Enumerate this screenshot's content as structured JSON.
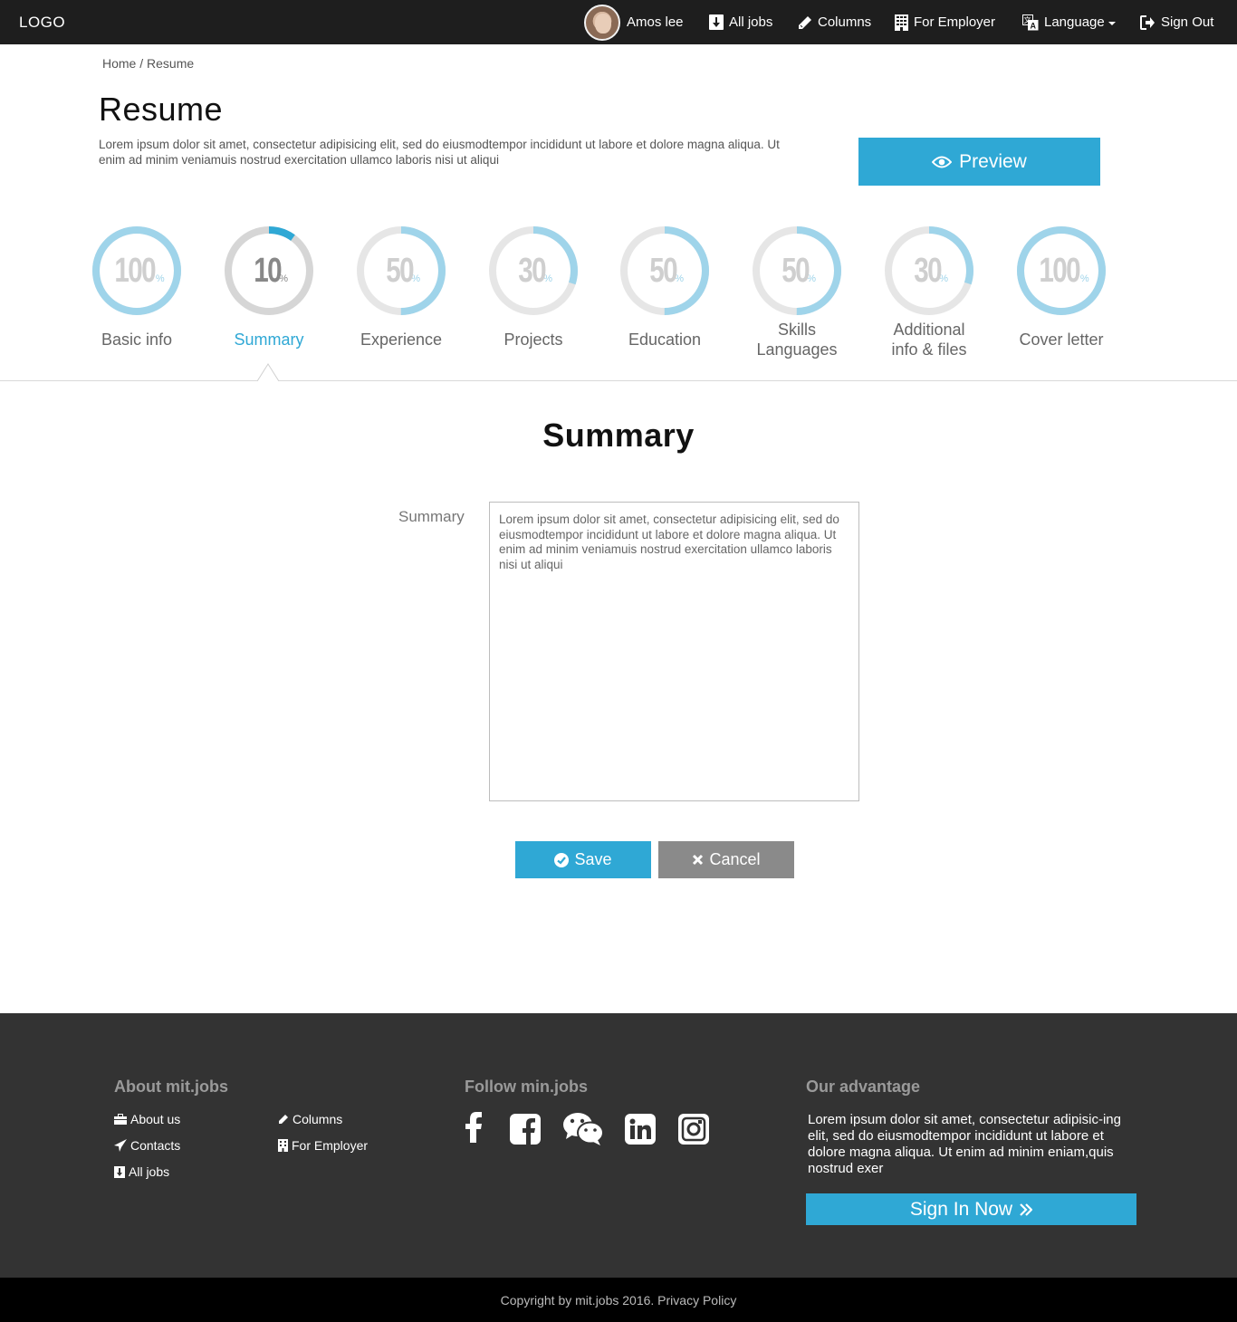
{
  "nav": {
    "logo": "LOGO",
    "user_name": "Amos lee",
    "all_jobs": "All jobs",
    "columns": "Columns",
    "for_employer": "For Employer",
    "language": "Language",
    "sign_out": "Sign Out"
  },
  "breadcrumb": "Home / Resume",
  "page": {
    "title": "Resume",
    "intro": "Lorem ipsum dolor sit amet, consectetur adipisicing elit, sed do eiusmodtempor incididunt ut labore et dolore magna aliqua. Ut enim ad minim veniamuis nostrud exercitation ullamco laboris nisi ut aliqui",
    "preview_label": "Preview"
  },
  "steps": [
    {
      "label": "Basic info",
      "value": "100",
      "percent": 100
    },
    {
      "label": "Summary",
      "value": "10",
      "percent": 10
    },
    {
      "label": "Experience",
      "value": "50",
      "percent": 50
    },
    {
      "label": "Projects",
      "value": "30",
      "percent": 30
    },
    {
      "label": "Education",
      "value": "50",
      "percent": 50
    },
    {
      "label": "Skills\nLanguages",
      "value": "50",
      "percent": 50
    },
    {
      "label": "Additional\ninfo & files",
      "value": "30",
      "percent": 30
    },
    {
      "label": "Cover letter",
      "value": "100",
      "percent": 100
    }
  ],
  "percent_sign": "%",
  "form": {
    "section_title": "Summary",
    "field_label": "Summary",
    "field_value": "Lorem ipsum dolor sit amet, consectetur adipisicing elit, sed do eiusmodtempor incididunt ut labore et dolore magna aliqua. Ut enim ad minim veniamuis nostrud exercitation ullamco laboris nisi ut aliqui",
    "save_label": "Save",
    "cancel_label": "Cancel"
  },
  "footer": {
    "about_heading": "About mit.jobs",
    "about_us": "About us",
    "contacts": "Contacts",
    "all_jobs": "All jobs",
    "columns": "Columns",
    "for_employer": "For Employer",
    "follow_heading": "Follow min.jobs",
    "advantage_heading": "Our advantage",
    "advantage_text": "Lorem ipsum dolor sit amet, consectetur adipisic-ing elit, sed do eiusmodtempor incididunt ut labore et dolore magna aliqua. Ut enim ad minim eniam,quis nostrud exer",
    "sign_in_label": "Sign In Now",
    "copyright": "Copyright by mit.jobs 2016. Privacy Policy"
  },
  "icons": {
    "social": [
      "facebook-icon",
      "facebook-square-icon",
      "wechat-icon",
      "linkedin-icon",
      "instagram-icon"
    ]
  },
  "colors": {
    "accent": "#2fa8d5",
    "ring_light": "#9fd4ea",
    "ring_track": "#e6e6e6",
    "topbar": "#1e1e1e",
    "footer": "#333333",
    "cancel": "#8a8a8a"
  }
}
